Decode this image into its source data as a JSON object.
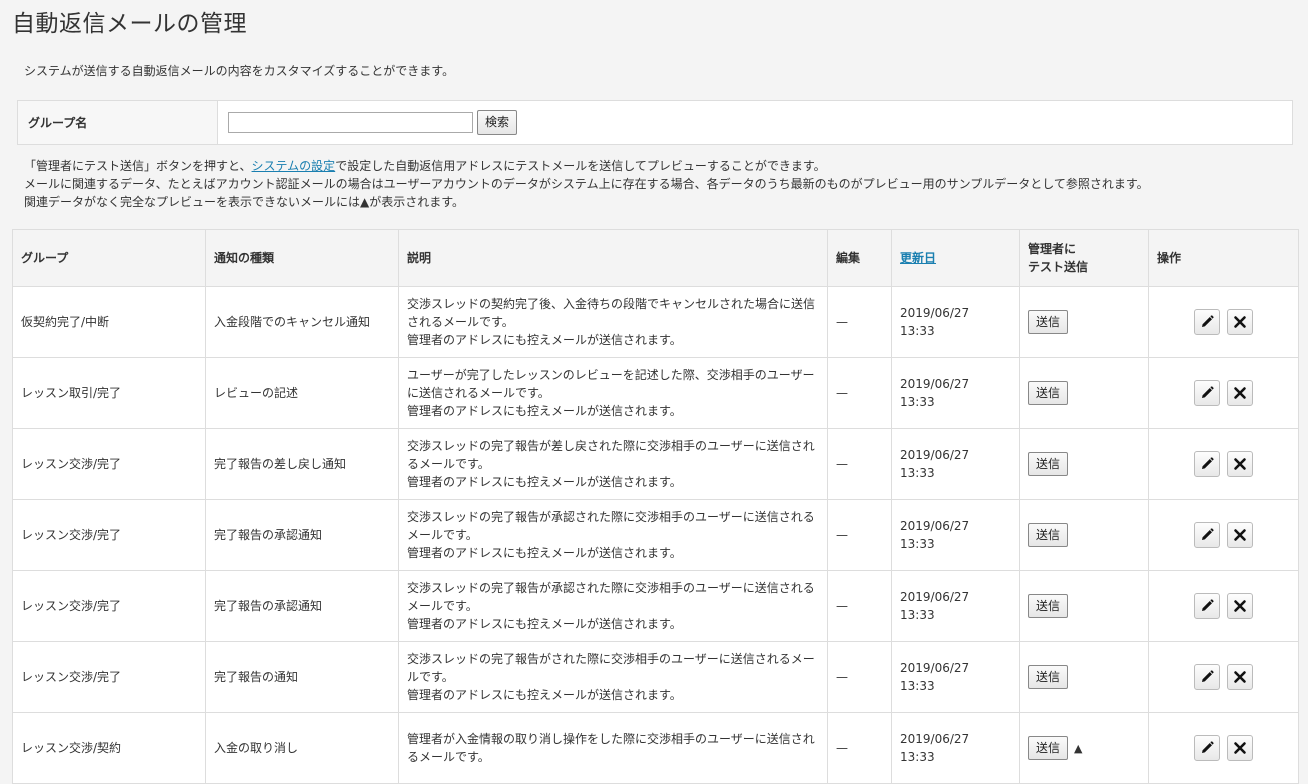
{
  "page": {
    "title": "自動返信メールの管理",
    "intro": "システムが送信する自動返信メールの内容をカスタマイズすることができます。"
  },
  "search": {
    "label": "グループ名",
    "value": "",
    "placeholder": "",
    "button": "検索"
  },
  "notes": {
    "line1_before": "「管理者にテスト送信」ボタンを押すと、",
    "line1_link": "システムの設定",
    "line1_after": "で設定した自動返信用アドレスにテストメールを送信してプレビューすることができます。",
    "line2": "メールに関連するデータ、たとえばアカウント認証メールの場合はユーザーアカウントのデータがシステム上に存在する場合、各データのうち最新のものがプレビュー用のサンプルデータとして参照されます。",
    "line3": "関連データがなく完全なプレビューを表示できないメールには▲が表示されます。"
  },
  "table": {
    "headers": {
      "group": "グループ",
      "type": "通知の種類",
      "description": "説明",
      "edit": "編集",
      "updated": "更新日",
      "test_line1": "管理者に",
      "test_line2": "テスト送信",
      "ops": "操作"
    },
    "rows": [
      {
        "group": "仮契約完了/中断",
        "type": "入金段階でのキャンセル通知",
        "desc1": "交渉スレッドの契約完了後、入金待ちの段階でキャンセルされた場合に送信",
        "desc2": "されるメールです。",
        "desc3": "管理者のアドレスにも控えメールが送信されます。",
        "edit": "—",
        "date": "2019/06/27",
        "time": "13:33",
        "send": "送信",
        "warn": ""
      },
      {
        "group": "レッスン取引/完了",
        "type": "レビューの記述",
        "desc1": "ユーザーが完了したレッスンのレビューを記述した際、交渉相手のユーザー",
        "desc2": "に送信されるメールです。",
        "desc3": "管理者のアドレスにも控えメールが送信されます。",
        "edit": "—",
        "date": "2019/06/27",
        "time": "13:33",
        "send": "送信",
        "warn": ""
      },
      {
        "group": "レッスン交渉/完了",
        "type": "完了報告の差し戻し通知",
        "desc1": "交渉スレッドの完了報告が差し戻された際に交渉相手のユーザーに送信され",
        "desc2": "るメールです。",
        "desc3": "管理者のアドレスにも控えメールが送信されます。",
        "edit": "—",
        "date": "2019/06/27",
        "time": "13:33",
        "send": "送信",
        "warn": ""
      },
      {
        "group": "レッスン交渉/完了",
        "type": "完了報告の承認通知",
        "desc1": "交渉スレッドの完了報告が承認された際に交渉相手のユーザーに送信される",
        "desc2": "メールです。",
        "desc3": "管理者のアドレスにも控えメールが送信されます。",
        "edit": "—",
        "date": "2019/06/27",
        "time": "13:33",
        "send": "送信",
        "warn": ""
      },
      {
        "group": "レッスン交渉/完了",
        "type": "完了報告の承認通知",
        "desc1": "交渉スレッドの完了報告が承認された際に交渉相手のユーザーに送信される",
        "desc2": "メールです。",
        "desc3": "管理者のアドレスにも控えメールが送信されます。",
        "edit": "—",
        "date": "2019/06/27",
        "time": "13:33",
        "send": "送信",
        "warn": ""
      },
      {
        "group": "レッスン交渉/完了",
        "type": "完了報告の通知",
        "desc1": "交渉スレッドの完了報告がされた際に交渉相手のユーザーに送信されるメー",
        "desc2": "ルです。",
        "desc3": "管理者のアドレスにも控えメールが送信されます。",
        "edit": "—",
        "date": "2019/06/27",
        "time": "13:33",
        "send": "送信",
        "warn": ""
      },
      {
        "group": "レッスン交渉/契約",
        "type": "入金の取り消し",
        "desc1": "管理者が入金情報の取り消し操作をした際に交渉相手のユーザーに送信され",
        "desc2": "るメールです。",
        "desc3": "",
        "edit": "—",
        "date": "2019/06/27",
        "time": "13:33",
        "send": "送信",
        "warn": "▲"
      }
    ],
    "icons": {
      "edit": "pencil-icon",
      "delete": "close-icon"
    }
  }
}
